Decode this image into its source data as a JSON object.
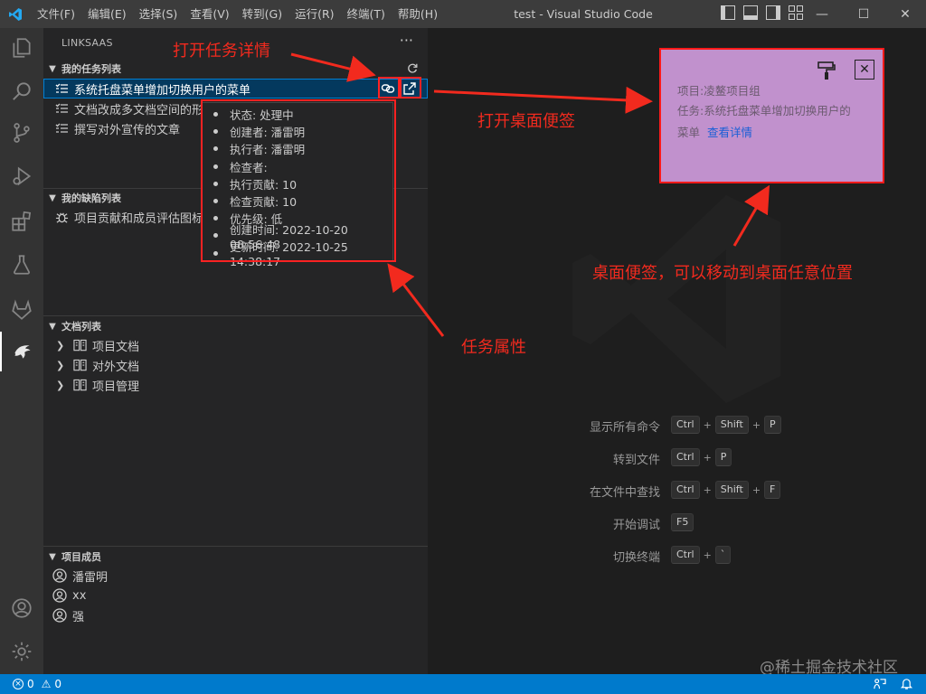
{
  "window": {
    "title": "test - Visual Studio Code"
  },
  "menu": [
    "文件(F)",
    "编辑(E)",
    "选择(S)",
    "查看(V)",
    "转到(G)",
    "运行(R)",
    "终端(T)",
    "帮助(H)"
  ],
  "window_controls": {
    "minimize": "—",
    "maximize": "☐",
    "close": "✕"
  },
  "sidebar": {
    "title": "LINKSAAS",
    "more": "···",
    "sections": {
      "tasks": {
        "header": "我的任务列表",
        "items": [
          "系统托盘菜单增加切换用户的菜单",
          "文档改成多文档空间的形式",
          "撰写对外宣传的文章"
        ]
      },
      "bugs": {
        "header": "我的缺陷列表",
        "items": [
          "项目贡献和成员评估图标"
        ]
      },
      "docs": {
        "header": "文档列表",
        "items": [
          "项目文档",
          "对外文档",
          "项目管理"
        ]
      },
      "members": {
        "header": "项目成员",
        "items": [
          "潘雷明",
          "xx",
          "强"
        ]
      }
    }
  },
  "tooltip": {
    "items": [
      "状态: 处理中",
      "创建者: 潘雷明",
      "执行者: 潘雷明",
      "检查者:",
      "执行贡献: 10",
      "检查贡献: 10",
      "优先级: 低",
      "创建时间: 2022-10-20 08:56:48",
      "更新时间: 2022-10-25 14:38:17"
    ]
  },
  "sticky_note": {
    "project": "项目:凌鳌项目组",
    "task_line1": "任务:系统托盘菜单增加切换用户的",
    "task_line2": "菜单",
    "link": "查看详情",
    "close": "✕"
  },
  "shortcuts": [
    {
      "label": "显示所有命令",
      "keys": [
        "Ctrl",
        "+",
        "Shift",
        "+",
        "P"
      ]
    },
    {
      "label": "转到文件",
      "keys": [
        "Ctrl",
        "+",
        "P"
      ]
    },
    {
      "label": "在文件中查找",
      "keys": [
        "Ctrl",
        "+",
        "Shift",
        "+",
        "F"
      ]
    },
    {
      "label": "开始调试",
      "keys": [
        "F5"
      ]
    },
    {
      "label": "切换终端",
      "keys": [
        "Ctrl",
        "+",
        "`"
      ]
    }
  ],
  "annotations": {
    "open_detail": "打开任务详情",
    "open_sticky": "打开桌面便签",
    "sticky_move": "桌面便签，可以移动到桌面任意位置",
    "task_props": "任务属性"
  },
  "statusbar": {
    "errors": "0",
    "warnings": "0"
  },
  "watermark": "@稀土掘金技术社区",
  "colors": {
    "accent": "#007acc",
    "annotation": "#f22a1e",
    "sticky_bg": "#c191cd"
  }
}
